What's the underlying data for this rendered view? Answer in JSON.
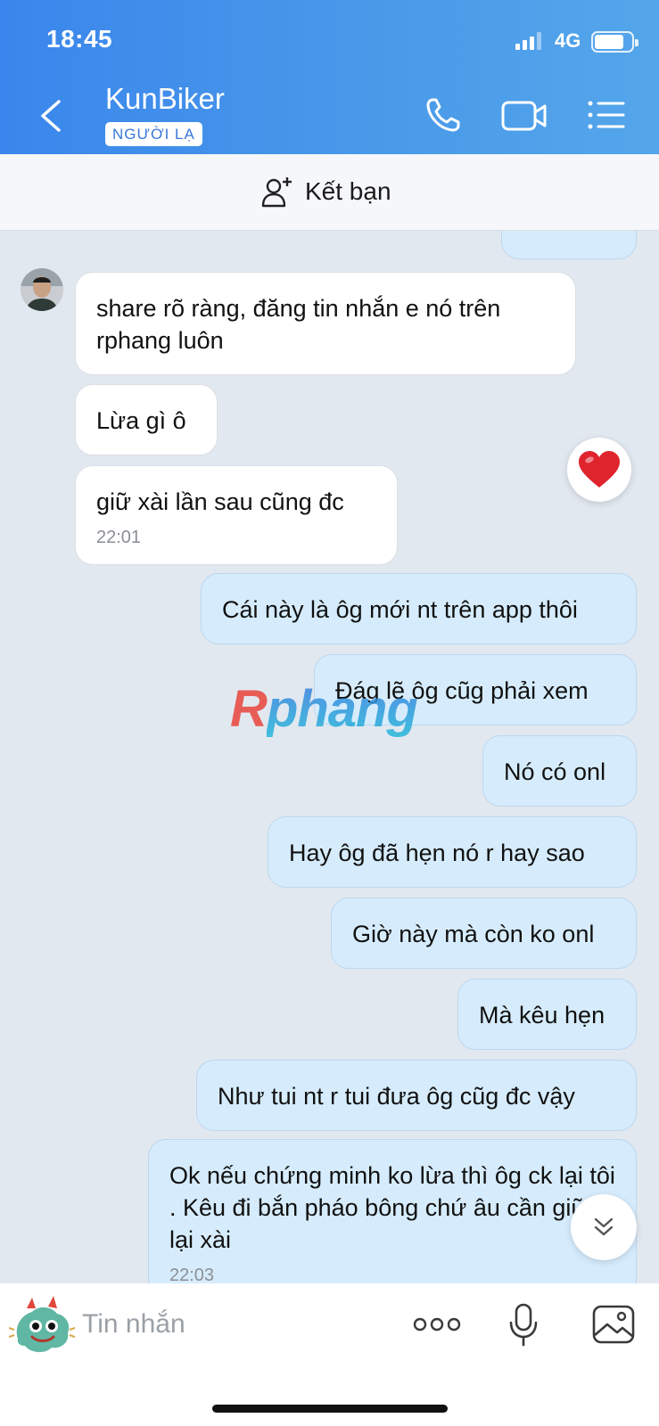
{
  "status_bar": {
    "time": "18:45",
    "network": "4G"
  },
  "header": {
    "contact_name": "KunBiker",
    "badge": "NGƯỜI LẠ"
  },
  "friend_bar": {
    "label": "Kết bạn"
  },
  "messages": [
    {
      "text": "share rõ ràng, đăng tin nhắn e nó trên rphang luôn"
    },
    {
      "text": "Lừa gì ô"
    },
    {
      "text": "giữ xài lần sau cũng đc",
      "time": "22:01"
    },
    {
      "text": "Cái này là ôg mới nt trên app thôi"
    },
    {
      "text": "Đág lẽ ôg cũg phải xem"
    },
    {
      "text": "Nó có onl"
    },
    {
      "text": "Hay ôg đã hẹn nó r hay sao"
    },
    {
      "text": "Giờ này mà còn ko onl"
    },
    {
      "text": "Mà kêu hẹn"
    },
    {
      "text": "Như tui nt r tui đưa ôg cũg đc vậy"
    },
    {
      "text": "Ok nếu chứng minh ko lừa thì ôg ck lại tôi . Kêu đi bắn pháo bông chứ âu cần giữ lại xài",
      "time": "22:03"
    }
  ],
  "watermark": {
    "first": "R",
    "rest": "phang"
  },
  "input": {
    "placeholder": "Tin nhắn"
  },
  "colors": {
    "header": "#3a86ec",
    "outgoing": "#d6ecfc",
    "incoming": "#ffffff",
    "background": "#e2e8f0"
  }
}
